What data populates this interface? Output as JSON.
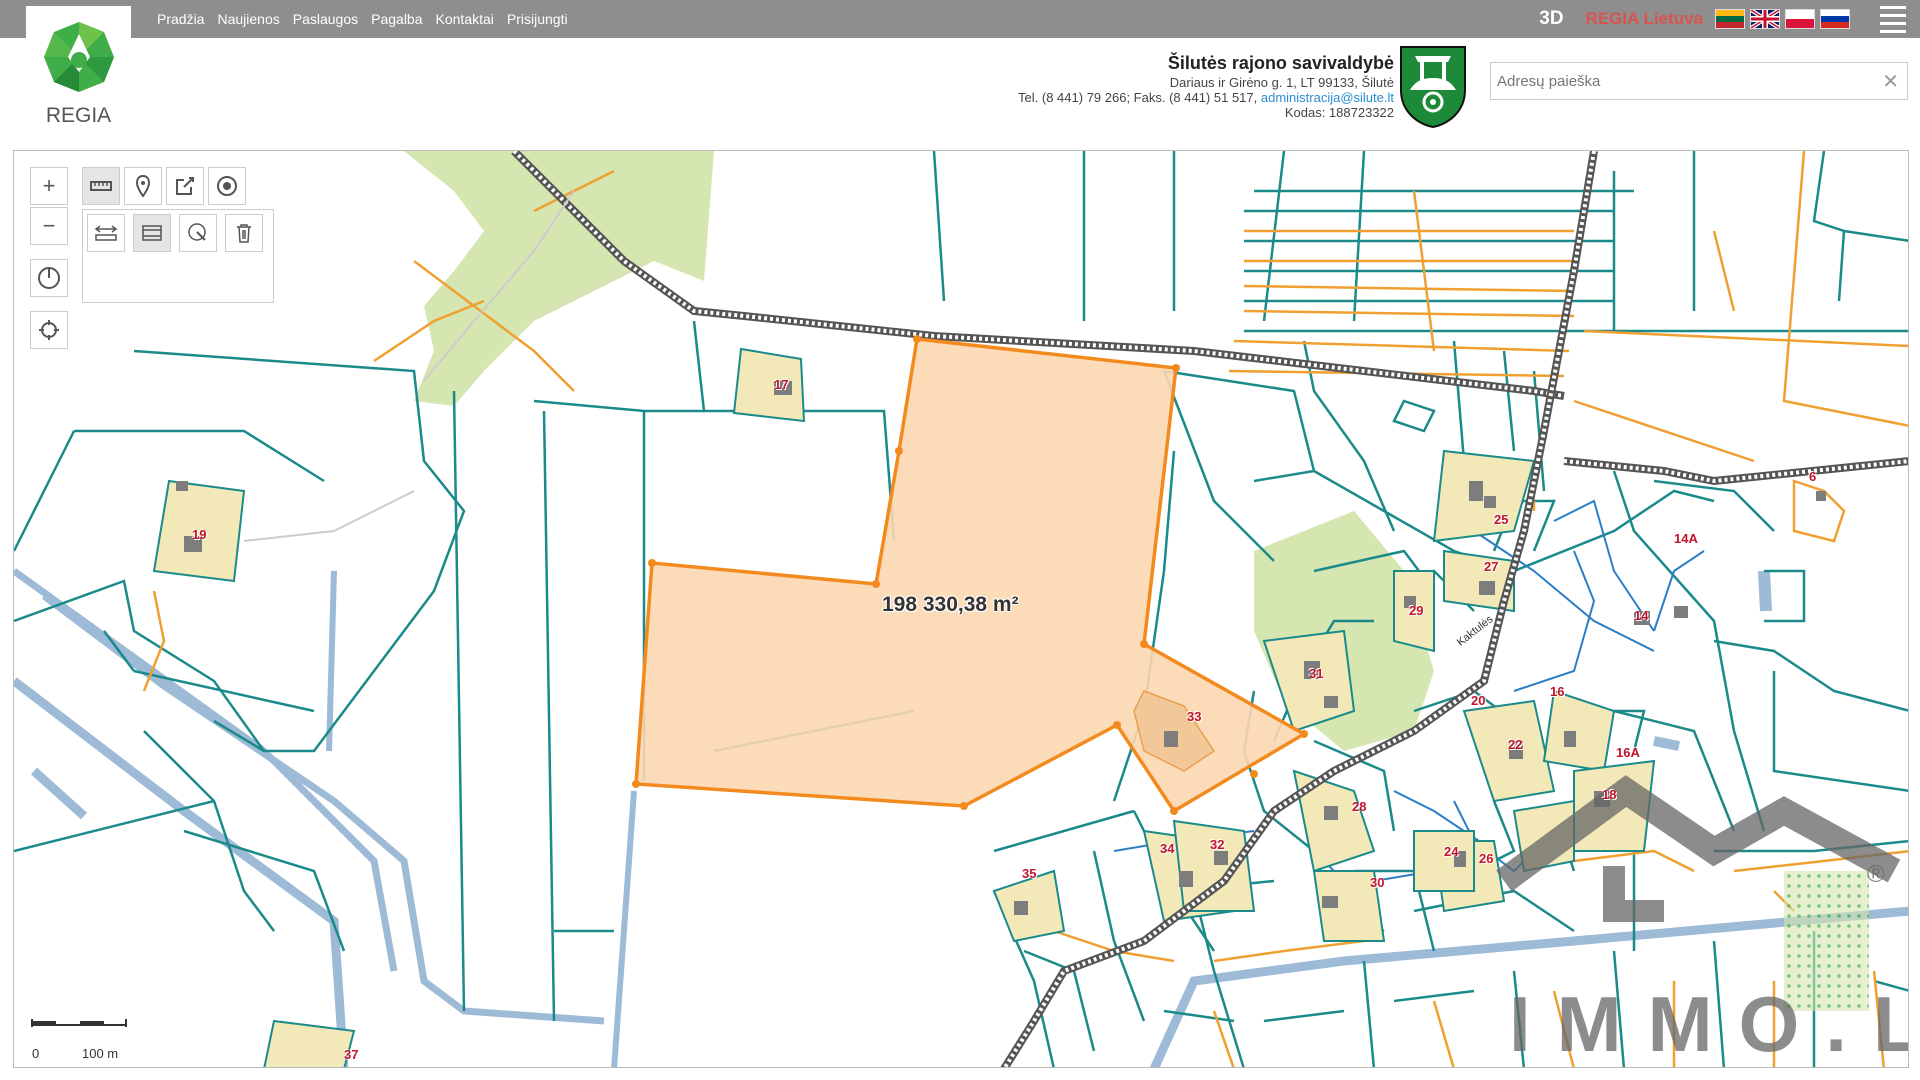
{
  "app": {
    "logo_text": "REGIA"
  },
  "nav": {
    "items": [
      "Pradžia",
      "Naujienos",
      "Paslaugos",
      "Pagalba",
      "Kontaktai",
      "Prisijungti"
    ]
  },
  "top_right": {
    "btn_3d": "3D",
    "regia_lietuva": "REGIA Lietuva",
    "flags": [
      "lt",
      "gb",
      "pl",
      "ru"
    ]
  },
  "municipality": {
    "name": "Šilutės rajono savivaldybė",
    "address": "Dariaus ir Girėno g. 1, LT 99133, Šilutė",
    "phone": "Tel. (8 441) 79 266; Faks. (8 441) 51 517, ",
    "email": "administracija@silute.lt",
    "code": "Kodas: 188723322"
  },
  "search": {
    "placeholder": "Adresų paieška",
    "clear": "✕"
  },
  "map": {
    "area_label": "198 330,38 m²",
    "street_label": "Kaktulės",
    "scale": {
      "zero": "0",
      "distance": "100 m"
    },
    "plots": [
      "17",
      "19",
      "25",
      "27",
      "29",
      "31",
      "33",
      "6",
      "14A",
      "14",
      "16",
      "16A",
      "18",
      "20",
      "22",
      "24",
      "26",
      "28",
      "30",
      "32",
      "34",
      "35",
      "37"
    ],
    "colors": {
      "parcel": "#1a8a8a",
      "selected_fill": "#fcd7b1",
      "selected_stroke": "#f28a1e",
      "orange": "#f0a030",
      "forest": "#d6e6b0",
      "water": "#9dbad6"
    }
  },
  "watermark": {
    "text": "IMMO.LT",
    "registered": "®"
  },
  "icons": [
    "zoom-in-icon",
    "zoom-out-icon",
    "compass-icon",
    "locate-icon",
    "measure-icon",
    "marker-icon",
    "share-icon",
    "target-icon",
    "measure-length-icon",
    "measure-area-icon",
    "measure-radius-icon",
    "trash-icon"
  ]
}
